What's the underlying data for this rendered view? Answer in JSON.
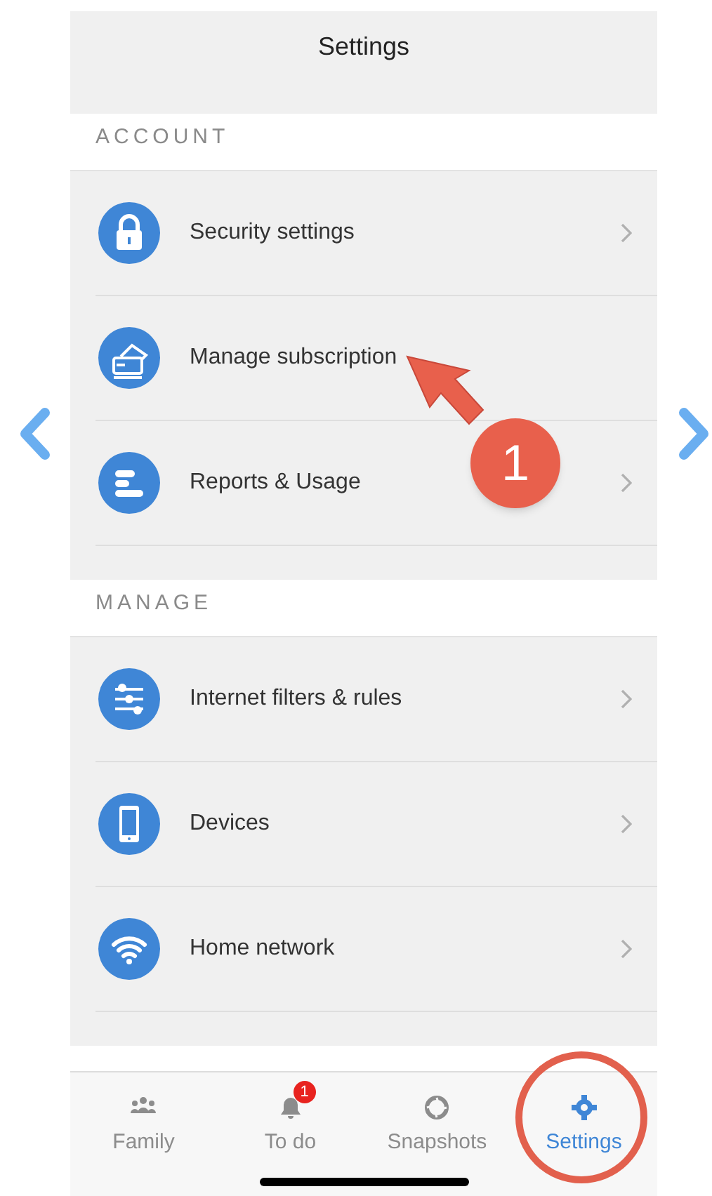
{
  "header": {
    "title": "Settings"
  },
  "sections": [
    {
      "label": "ACCOUNT",
      "items": [
        {
          "label": "Security settings",
          "chevron": true
        },
        {
          "label": "Manage subscription",
          "chevron": false
        },
        {
          "label": "Reports & Usage",
          "chevron": true
        }
      ]
    },
    {
      "label": "MANAGE",
      "items": [
        {
          "label": "Internet filters & rules",
          "chevron": true
        },
        {
          "label": "Devices",
          "chevron": true
        },
        {
          "label": "Home network",
          "chevron": true
        }
      ]
    }
  ],
  "tab_bar": [
    {
      "label": "Family",
      "selected": false
    },
    {
      "label": "To do",
      "selected": false,
      "badge": "1"
    },
    {
      "label": "Snapshots",
      "selected": false
    },
    {
      "label": "Settings",
      "selected": true
    }
  ],
  "annotations": [
    {
      "kind": "arrow",
      "label": "1"
    },
    {
      "kind": "ring"
    }
  ]
}
